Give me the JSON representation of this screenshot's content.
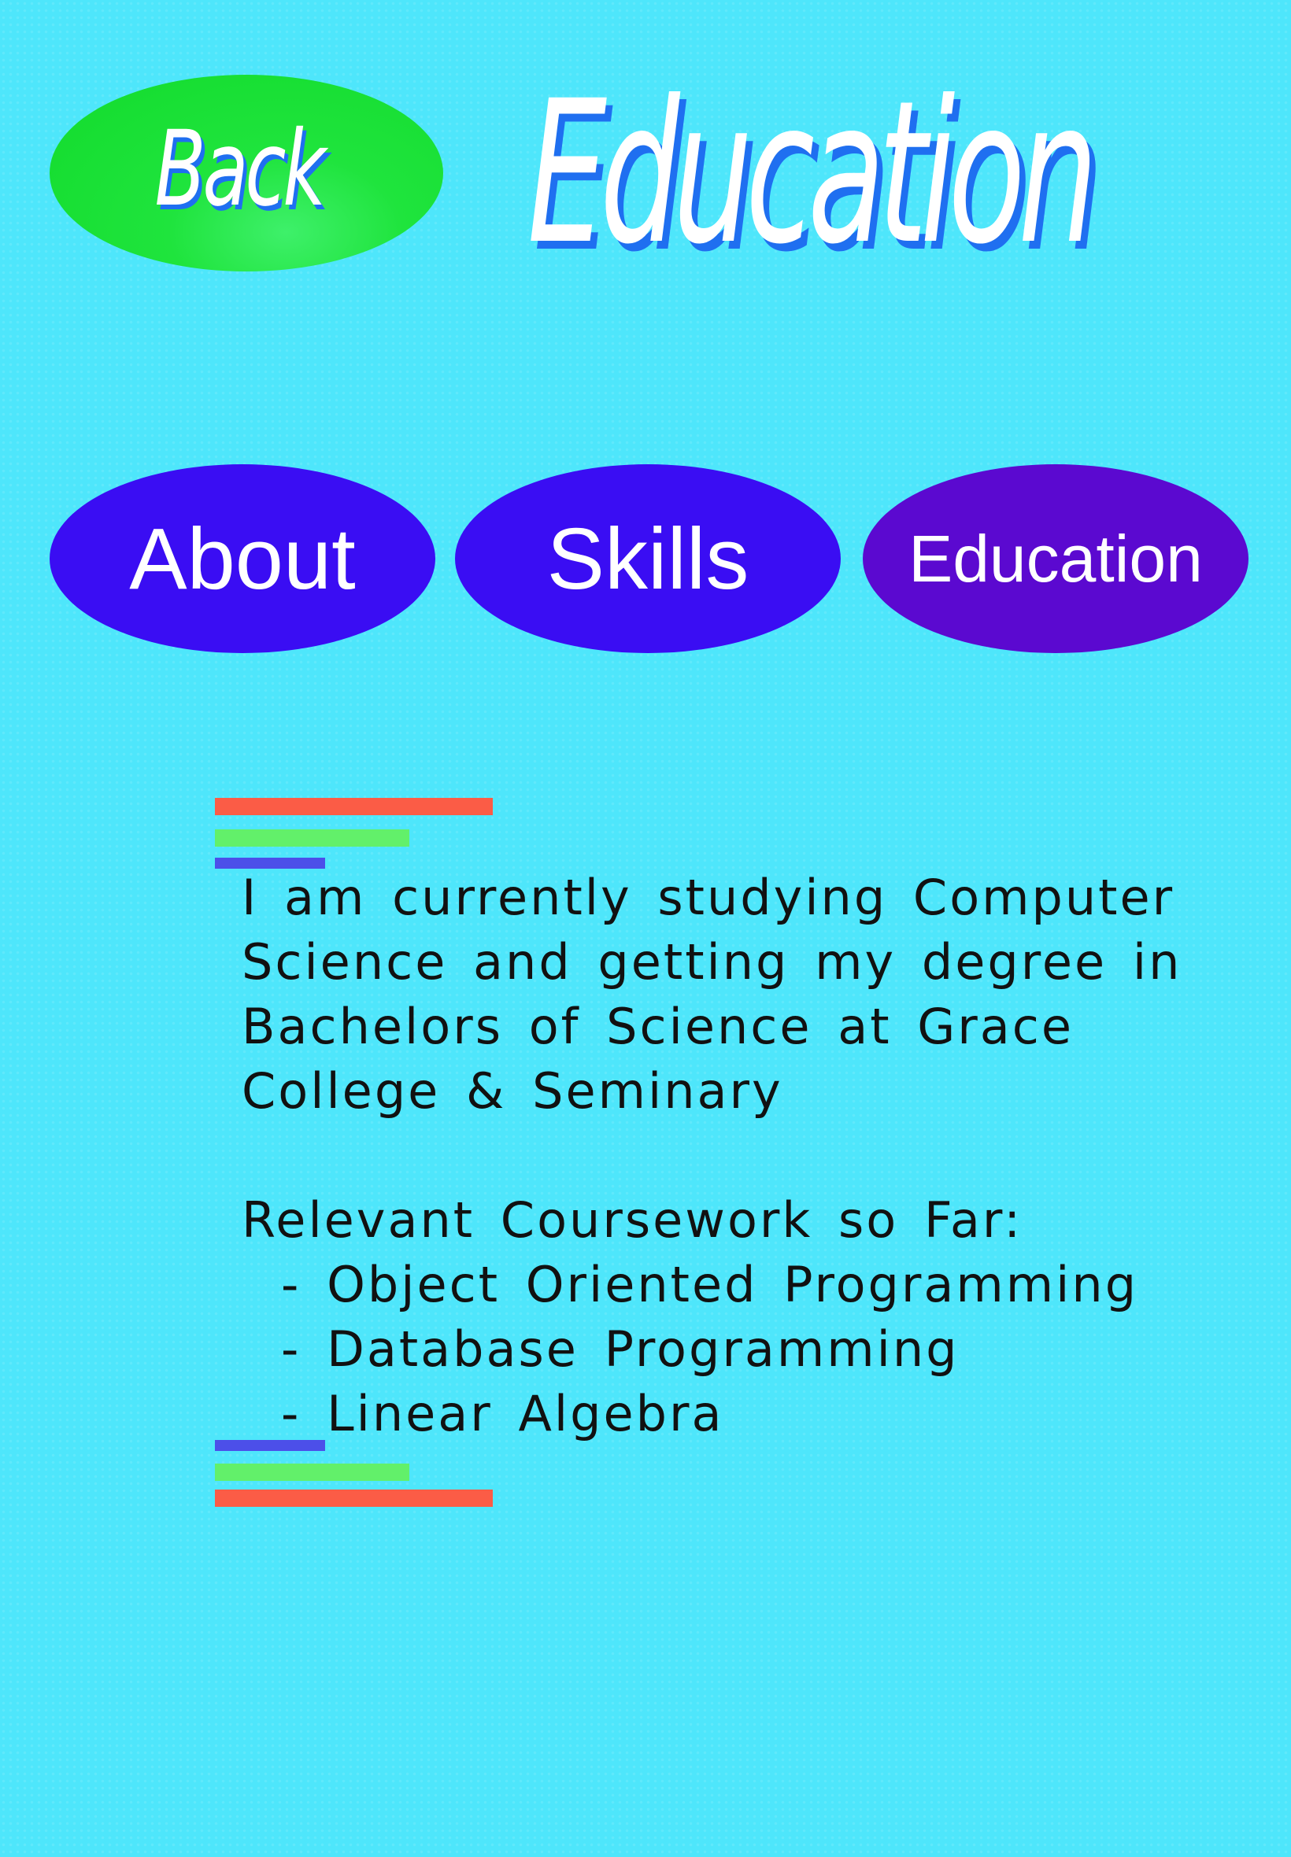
{
  "header": {
    "back_label": "Back",
    "title": "Education"
  },
  "nav": {
    "items": [
      {
        "label": "About"
      },
      {
        "label": "Skills"
      },
      {
        "label": "Education"
      }
    ]
  },
  "content": {
    "intro_lines": [
      "I am currently studying Computer",
      "Science and getting my degree in",
      "Bachelors of Science at Grace",
      "College & Seminary"
    ],
    "coursework_heading": "Relevant Coursework so Far:",
    "courses": [
      "- Object Oriented Programming",
      "- Database Programming",
      "- Linear Algebra"
    ]
  },
  "colors": {
    "background": "#4ee6fb",
    "back_button": "#12db2c",
    "nav_button": "#3a0df3",
    "nav_button_active": "#5b09d0",
    "title_shadow": "#1f6ff0",
    "bar_red": "#fb5c46",
    "bar_green": "#62f06a",
    "bar_blue": "#4c4fe9"
  }
}
